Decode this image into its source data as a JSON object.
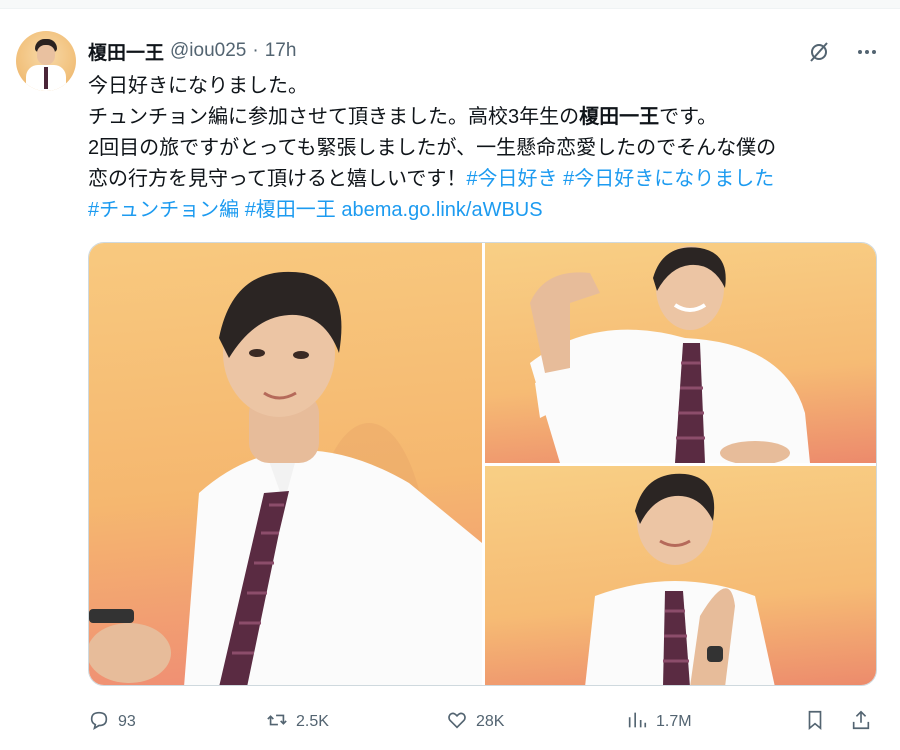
{
  "tweet": {
    "author_name": "榎田一王",
    "handle": "@iou025",
    "separator": "·",
    "time": "17h",
    "lines": {
      "l1": "今日好きになりました。",
      "l2_a": "チュンチョン編に参加させて頂きました。高校3年生の",
      "l2_bold": "榎田一王",
      "l2_b": "です。",
      "l3": "2回目の旅ですがとっても緊張しましたが、一生懸命恋愛したのでそんな僕の",
      "l4_a": "恋の行方を見守って頂けると嬉しいです！",
      "l4_tag1": "#今日好き",
      "l4_tag2": "#今日好きになりました",
      "l5_tag3": "#チュンチョン編",
      "l5_tag4": "#榎田一王",
      "l5_link": "abema.go.link/aWBUS"
    }
  },
  "metrics": {
    "replies": "93",
    "reposts": "2.5K",
    "likes": "28K",
    "views": "1.7M"
  },
  "icons": {
    "grok": "grok-slash-icon",
    "more": "more-dots-icon",
    "reply": "reply-bubble-icon",
    "repost": "repost-icon",
    "like": "heart-icon",
    "views": "views-chart-icon",
    "bookmark": "bookmark-icon",
    "share": "share-icon"
  },
  "colors": {
    "link": "#1d9bf0",
    "secondary_text": "#536471",
    "primary_text": "#0f1419"
  }
}
